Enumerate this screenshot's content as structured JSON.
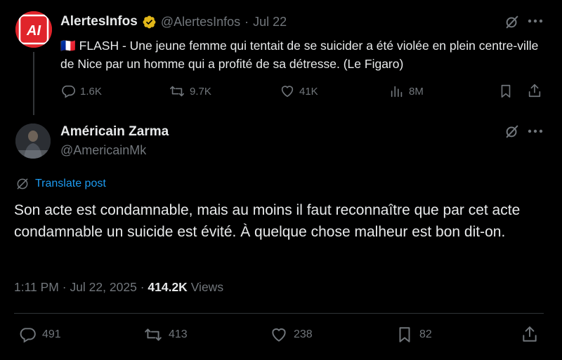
{
  "quoted_post": {
    "author_name": "AlertesInfos",
    "author_handle": "@AlertesInfos",
    "separator": "·",
    "date": "Jul 22",
    "avatar_text": "AI",
    "flag": "🇫🇷",
    "text": "FLASH - Une jeune femme qui tentait de se suicider a été violée en plein centre-ville de Nice par un homme qui a profité de sa détresse. (Le Figaro)",
    "stats": {
      "replies": "1.6K",
      "reposts": "9.7K",
      "likes": "41K",
      "views": "8M"
    }
  },
  "post": {
    "author_name": "Américain Zarma",
    "author_handle": "@AmericainMk",
    "translate_label": "Translate post",
    "text": "Son acte est condamnable, mais au moins il faut reconnaître que par cet acte condamnable un suicide est évité. À quelque chose malheur est bon dit-on.",
    "time": "1:11 PM",
    "separator": "·",
    "date": "Jul 22, 2025",
    "views_count": "414.2K",
    "views_label": "Views",
    "stats": {
      "replies": "491",
      "reposts": "413",
      "likes": "238",
      "bookmarks": "82"
    }
  },
  "colors": {
    "background": "#000000",
    "text": "#e7e9ea",
    "muted": "#71767b",
    "link": "#1d9bf0",
    "verified_badge": "#e2b719",
    "avatar_brand": "#e0242b"
  }
}
